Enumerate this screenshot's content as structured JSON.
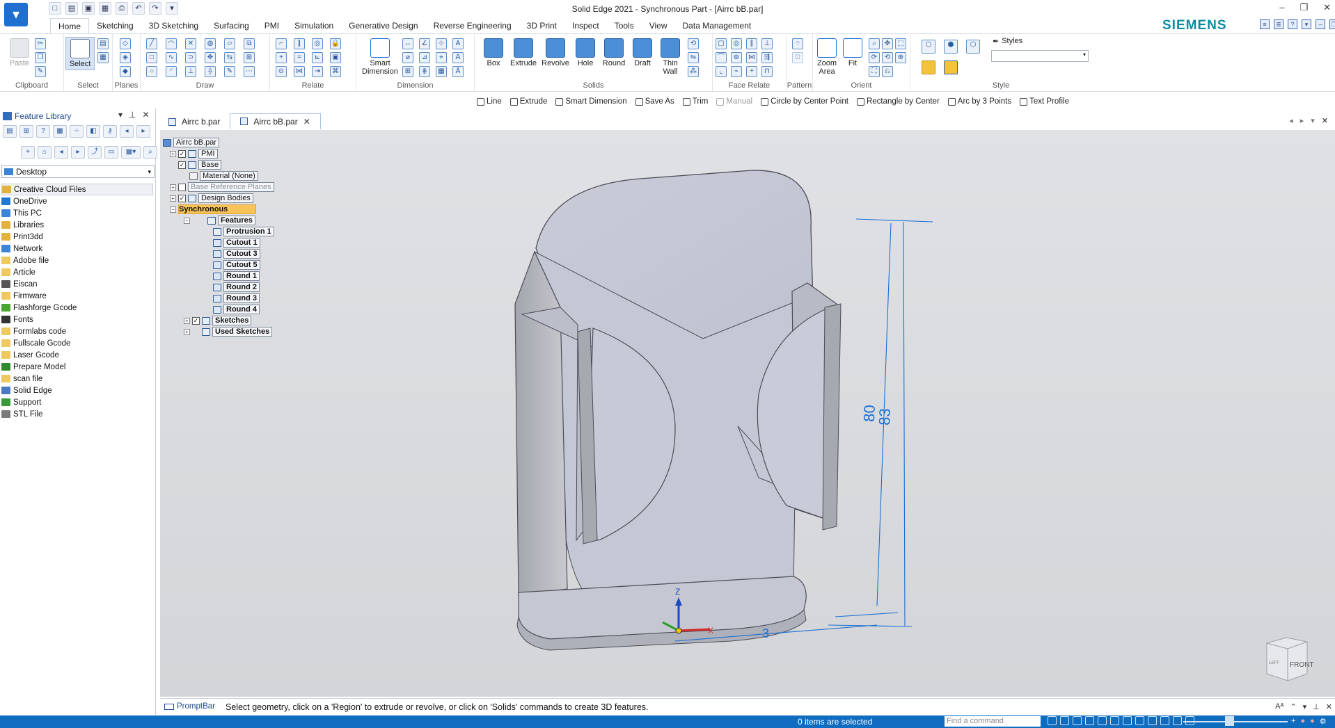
{
  "window_title": "Solid Edge 2021 - Synchronous Part - [Airrc bB.par]",
  "brand": "SIEMENS",
  "ribbon_tabs": [
    "Home",
    "Sketching",
    "3D Sketching",
    "Surfacing",
    "PMI",
    "Simulation",
    "Generative Design",
    "Reverse Engineering",
    "3D Print",
    "Inspect",
    "Tools",
    "View",
    "Data Management"
  ],
  "active_tab": "Home",
  "ribbon": {
    "clipboard": {
      "label": "Clipboard",
      "paste": "Paste"
    },
    "select": {
      "label": "Select",
      "select_btn": "Select"
    },
    "planes": {
      "label": "Planes"
    },
    "draw": {
      "label": "Draw"
    },
    "relate": {
      "label": "Relate"
    },
    "dimension": {
      "label": "Dimension",
      "smart_dimension": "Smart Dimension"
    },
    "solids": {
      "label": "Solids",
      "box": "Box",
      "extrude": "Extrude",
      "revolve": "Revolve",
      "hole": "Hole",
      "round": "Round",
      "draft": "Draft",
      "thin_wall": "Thin Wall"
    },
    "face_relate": {
      "label": "Face Relate"
    },
    "pattern": {
      "label": "Pattern"
    },
    "orient": {
      "label": "Orient",
      "zoom_area": "Zoom Area",
      "fit": "Fit"
    },
    "style": {
      "label": "Style",
      "styles": "Styles"
    }
  },
  "command_bar": [
    {
      "label": "Line",
      "icon": "line-icon",
      "enabled": true
    },
    {
      "label": "Extrude",
      "icon": "extrude-icon",
      "enabled": true
    },
    {
      "label": "Smart Dimension",
      "icon": "dimension-icon",
      "enabled": true
    },
    {
      "label": "Save As",
      "icon": "save-as-icon",
      "enabled": true
    },
    {
      "label": "Trim",
      "icon": "trim-icon",
      "enabled": true
    },
    {
      "label": "Manual",
      "icon": "manual-icon",
      "enabled": false
    },
    {
      "label": "Circle by Center Point",
      "icon": "circle-icon",
      "enabled": true
    },
    {
      "label": "Rectangle by Center",
      "icon": "rectangle-icon",
      "enabled": true
    },
    {
      "label": "Arc by 3 Points",
      "icon": "arc-icon",
      "enabled": true
    },
    {
      "label": "Text Profile",
      "icon": "text-icon",
      "enabled": true
    }
  ],
  "left_panel": {
    "title": "Feature Library",
    "location": "Desktop",
    "folders": [
      {
        "label": "Creative Cloud Files",
        "color": "#e3b23c",
        "highlight": true
      },
      {
        "label": "OneDrive",
        "color": "#1f78d1"
      },
      {
        "label": "This PC",
        "color": "#3b84d8"
      },
      {
        "label": "Libraries",
        "color": "#e3b23c"
      },
      {
        "label": "Print3dd",
        "color": "#e3b23c"
      },
      {
        "label": "Network",
        "color": "#3b84d8"
      },
      {
        "label": "Adobe file",
        "color": "#f0c860"
      },
      {
        "label": "Article",
        "color": "#f0c860"
      },
      {
        "label": "Eiscan",
        "color": "#555555"
      },
      {
        "label": "Firmware",
        "color": "#f0c860"
      },
      {
        "label": "Flashforge Gcode",
        "color": "#49a52f"
      },
      {
        "label": "Fonts",
        "color": "#333333"
      },
      {
        "label": "Formlabs code",
        "color": "#f0c860"
      },
      {
        "label": "Fullscale Gcode",
        "color": "#f0c860"
      },
      {
        "label": "Laser Gcode",
        "color": "#f0c860"
      },
      {
        "label": "Prepare Model",
        "color": "#2e8b2e"
      },
      {
        "label": "scan file",
        "color": "#f0c860"
      },
      {
        "label": "Solid Edge",
        "color": "#4b79c2"
      },
      {
        "label": "Support",
        "color": "#3a9a3a"
      },
      {
        "label": "STL File",
        "color": "#7a7a7a"
      }
    ]
  },
  "doc_tabs": [
    {
      "label": "Airrc b.par",
      "active": false
    },
    {
      "label": "Airrc bB.par",
      "active": true
    }
  ],
  "pathfinder": {
    "root": "Airrc bB.par",
    "pmi": "PMI",
    "base": "Base",
    "material": "Material (None)",
    "base_ref_planes": "Base Reference Planes",
    "design_bodies": "Design Bodies",
    "synchronous": "Synchronous",
    "features_node": "Features",
    "features": [
      "Protrusion 1",
      "Cutout 1",
      "Cutout 3",
      "Cutout 5",
      "Round 1",
      "Round 2",
      "Round 3",
      "Round 4"
    ],
    "sketches": "Sketches",
    "used_sketches": "Used Sketches"
  },
  "model": {
    "dimension_outer": "80",
    "dimension_inner": "83",
    "dimension_bottom": "3",
    "axis_z": "Z",
    "axis_x": "X",
    "view_cube_front": "FRONT",
    "view_cube_left": "LEFT"
  },
  "prompt_bar": {
    "label": "PromptBar",
    "text": "Select geometry, click on a 'Region' to extrude or revolve, or click on 'Solids' commands to create 3D features."
  },
  "status": {
    "selection": "0 items are selected",
    "find_placeholder": "Find a command"
  },
  "colors": {
    "accent": "#0f6cbf",
    "dimension": "#1a6fd6",
    "sync_highlight": "#f8c45a"
  }
}
